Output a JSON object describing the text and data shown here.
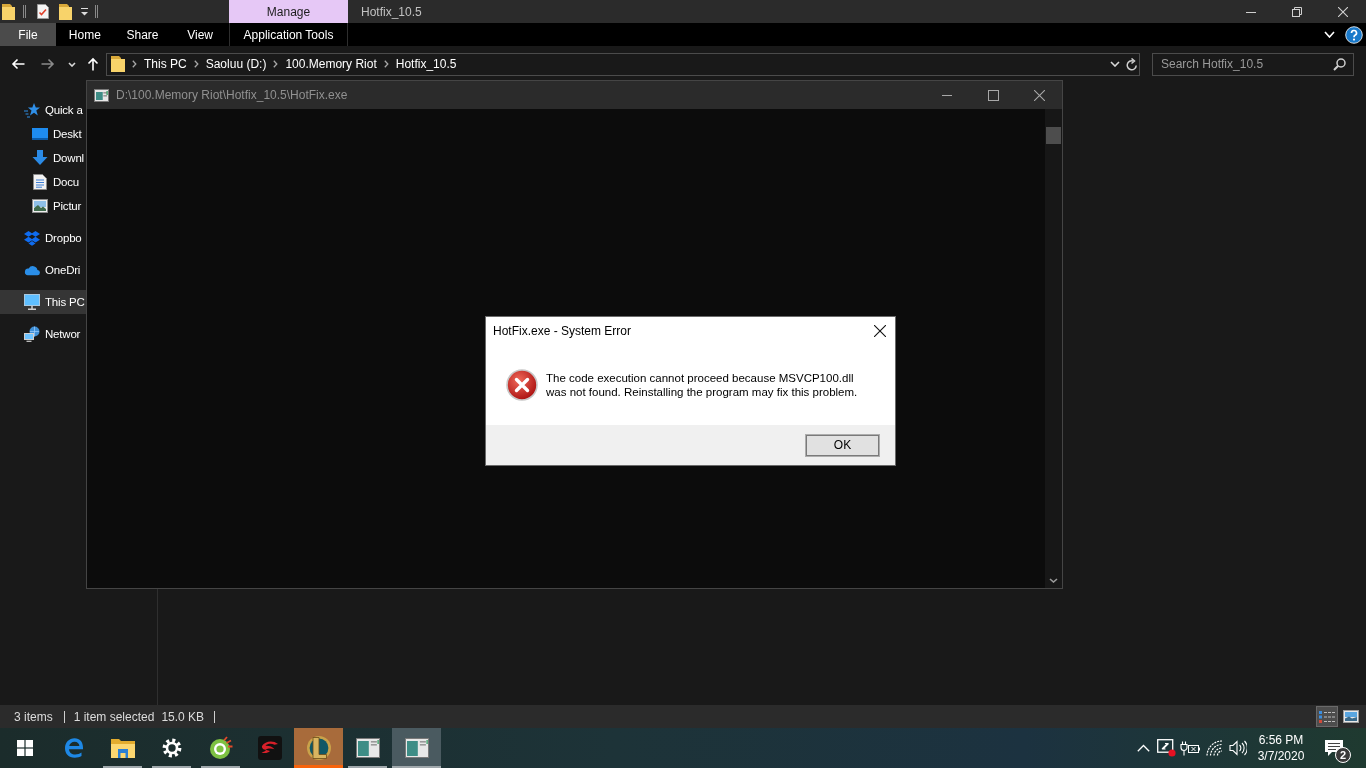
{
  "explorer": {
    "title_bar": {
      "contextual_group": "Manage",
      "title": "Hotfix_10.5"
    },
    "ribbon_tabs": [
      {
        "kind": "file",
        "label": "File"
      },
      {
        "kind": "tab",
        "label": "Home"
      },
      {
        "kind": "tab",
        "label": "Share"
      },
      {
        "kind": "tab",
        "label": "View"
      },
      {
        "kind": "contextual",
        "label": "Application Tools"
      }
    ],
    "address_bar": {
      "path": [
        "This PC",
        "Saoluu (D:)",
        "100.Memory Riot",
        "Hotfix_10.5"
      ]
    },
    "search": {
      "placeholder": "Search Hotfix_10.5"
    },
    "sidebar": {
      "items": [
        {
          "kind": "quick_access",
          "label": "Quick a",
          "selected": false,
          "children": [
            {
              "kind": "desktop",
              "label": "Deskt",
              "selected": false
            },
            {
              "kind": "downloads",
              "label": "Downl",
              "selected": false
            },
            {
              "kind": "documents",
              "label": "Docu",
              "selected": false
            },
            {
              "kind": "pictures",
              "label": "Pictur",
              "selected": false
            }
          ]
        },
        {
          "kind": "dropbox",
          "label": "Dropbo",
          "selected": false
        },
        {
          "kind": "onedrive",
          "label": "OneDri",
          "selected": false
        },
        {
          "kind": "this_pc",
          "label": "This PC",
          "selected": true
        },
        {
          "kind": "network",
          "label": "Networ",
          "selected": false
        }
      ]
    },
    "status_bar": {
      "item_count": "3 items",
      "selected_count": "1 item selected",
      "selected_size": "15.0 KB",
      "views": [
        {
          "kind": "details",
          "selected": true
        },
        {
          "kind": "large_icons",
          "selected": false
        }
      ]
    }
  },
  "console_window": {
    "title": "D:\\100.Memory Riot\\Hotfix_10.5\\HotFix.exe"
  },
  "error_dialog": {
    "title": "HotFix.exe - System Error",
    "message": "The code execution cannot proceed because MSVCP100.dll\nwas not found. Reinstalling the program may fix this problem.",
    "buttons": [
      "OK"
    ]
  },
  "taskbar": {
    "apps": [
      {
        "kind": "browser",
        "running": false,
        "selected": false,
        "flashing": false
      },
      {
        "kind": "file_explorer",
        "running": true,
        "selected": false,
        "flashing": false
      },
      {
        "kind": "settings",
        "running": true,
        "selected": false,
        "flashing": false
      },
      {
        "kind": "browser_2",
        "running": true,
        "selected": false,
        "flashing": false
      },
      {
        "kind": "game_launcher",
        "running": false,
        "selected": false,
        "flashing": false
      },
      {
        "kind": "game",
        "running": true,
        "selected": false,
        "flashing": true
      },
      {
        "kind": "program",
        "running": true,
        "selected": false,
        "flashing": false
      },
      {
        "kind": "program",
        "running": true,
        "selected": true,
        "flashing": false
      }
    ],
    "clock": {
      "time": "6:56 PM",
      "date": "3/7/2020"
    },
    "notification_count": "2"
  }
}
